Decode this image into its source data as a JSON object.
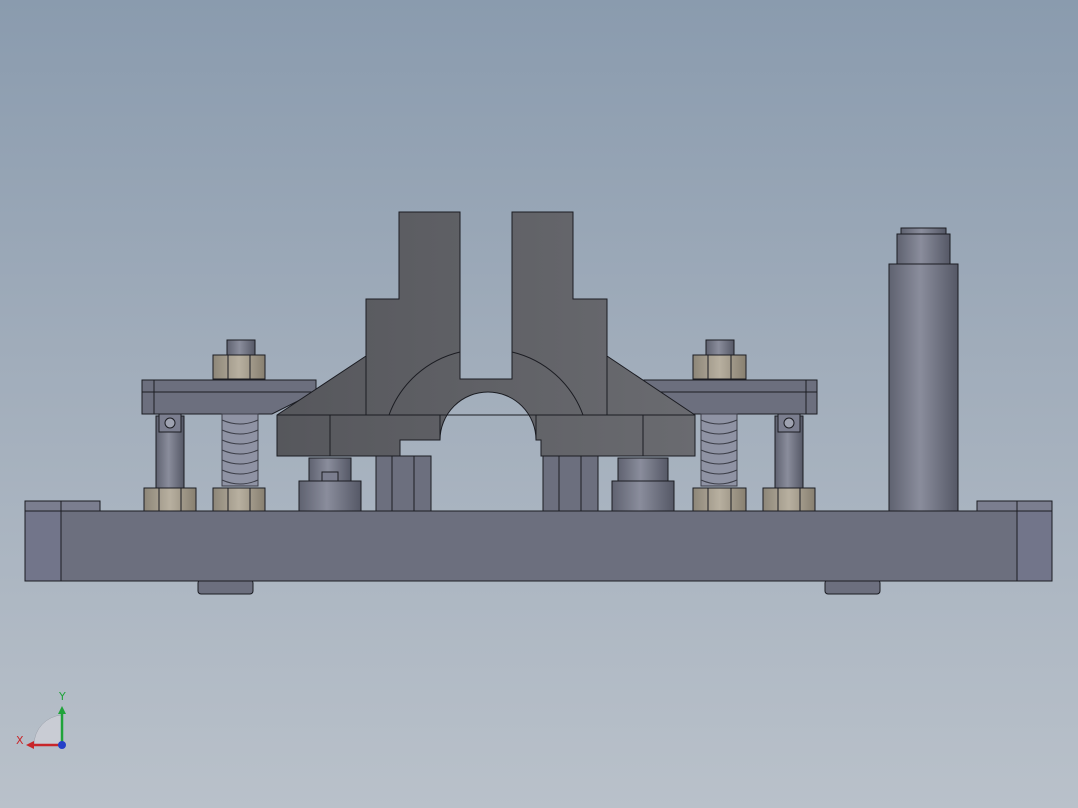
{
  "viewport": {
    "background_top": "#8a9bae",
    "background_bottom": "#b9c1ca"
  },
  "model": {
    "part_color": "#6c6f7e",
    "part_edge_color": "#1b1c22",
    "clamp_jaw_color": "#5c5d62",
    "nut_color": "#a8a090",
    "spring_color": "#8f93a4"
  },
  "triad": {
    "x_label": "X",
    "y_label": "Y",
    "x_color": "#c8262a",
    "y_color": "#1fa33a",
    "z_color": "#2440c8"
  }
}
